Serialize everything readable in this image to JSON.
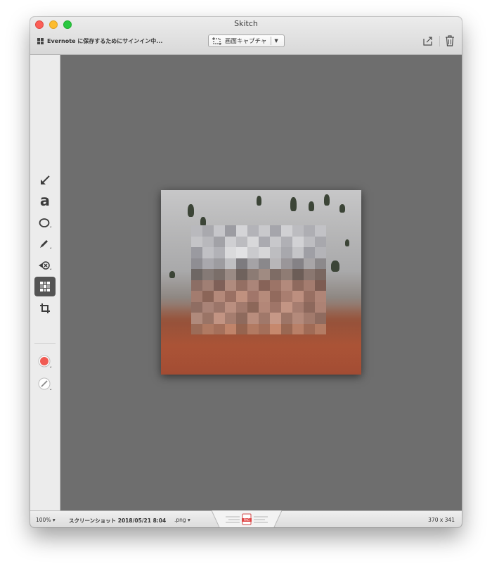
{
  "window": {
    "title": "Skitch"
  },
  "header": {
    "evernote_status": "Evernote に保存するためにサインイン中...",
    "capture_label": "画面キャプチャ"
  },
  "tools": [
    {
      "name": "arrow-tool",
      "icon": "arrow-icon"
    },
    {
      "name": "text-tool",
      "icon": "text-a-icon",
      "glyph": "a"
    },
    {
      "name": "shape-tool",
      "icon": "ellipse-icon"
    },
    {
      "name": "pen-tool",
      "icon": "pen-icon"
    },
    {
      "name": "stamp-tool",
      "icon": "stamp-icon"
    },
    {
      "name": "pixelate-tool",
      "icon": "pixelate-icon",
      "selected": true
    },
    {
      "name": "crop-tool",
      "icon": "crop-icon"
    },
    {
      "name": "color-tool",
      "icon": "color-swatch-icon",
      "color": "#f05a52"
    },
    {
      "name": "size-tool",
      "icon": "line-size-icon"
    }
  ],
  "status": {
    "zoom": "100%",
    "filename": "スクリーンショット 2018/05/21 8:04",
    "filetype": ".png",
    "dimensions": "370 x 341",
    "drag_badge": "PNG"
  },
  "colors": {
    "canvas_bg": "#6e6e6e",
    "accent_red": "#f05a52"
  }
}
